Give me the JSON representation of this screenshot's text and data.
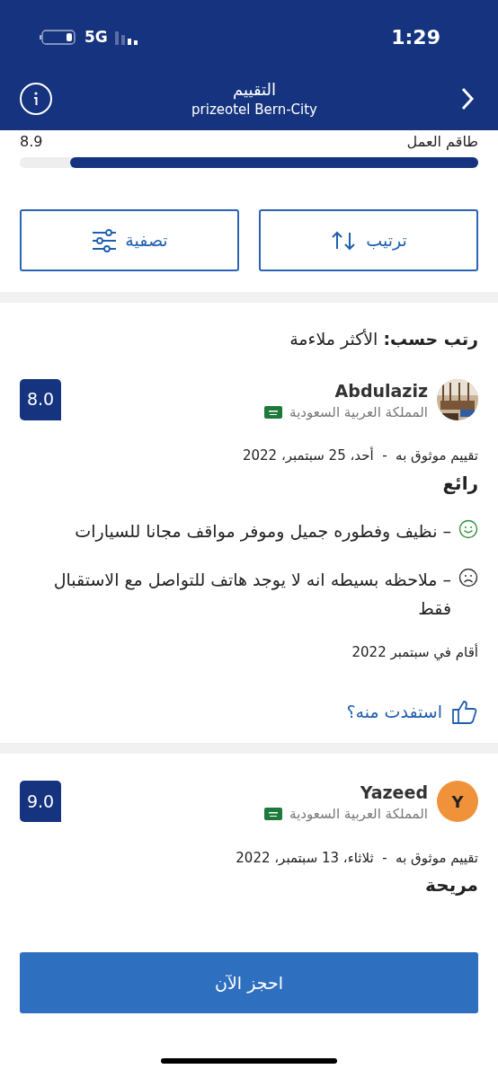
{
  "status_bar": {
    "time": "1:29",
    "network": "5G"
  },
  "header": {
    "title": "التقييم",
    "subtitle": "prizeotel Bern-City"
  },
  "category": {
    "name": "طاقم العمل",
    "score": "8.9",
    "level": 0.89
  },
  "actions": [
    {
      "kind": "sort",
      "label": "ترتيب"
    },
    {
      "kind": "filter",
      "label": "تصفية"
    }
  ],
  "sort_by": {
    "label": "رتب حسب:",
    "value": "الأكثر ملاءمة"
  },
  "reviews": [
    {
      "name": "Abdulaziz",
      "country": "المملكة العربية السعودية",
      "score": "8.0",
      "date": "تقييم موثوق به  -  أحد، 25 سبتمبر، 2022",
      "title": "رائع",
      "comments": [
        {
          "kind": "positive",
          "text": "–  نظيف وفطوره جميل وموفر مواقف مجانا للسيارات"
        },
        {
          "kind": "negative",
          "text": "–  ملاحظه بسيطه انه لا يوجد هاتف للتواصل مع الاستقبال فقط"
        }
      ],
      "stay": "أقام في سبتمبر 2022",
      "helpful": "استفدت منه؟"
    },
    {
      "name": "Yazeed",
      "country": "المملكة العربية السعودية",
      "score": "9.0",
      "avatar": {
        "kind": "letter",
        "letter": "Y",
        "color": "#f0923a"
      },
      "date": "تقييم موثوق به  -  ثلاثاء، 13 سبتمبر، 2022",
      "title": "مريحة"
    }
  ],
  "book_button": "احجز الآن"
}
